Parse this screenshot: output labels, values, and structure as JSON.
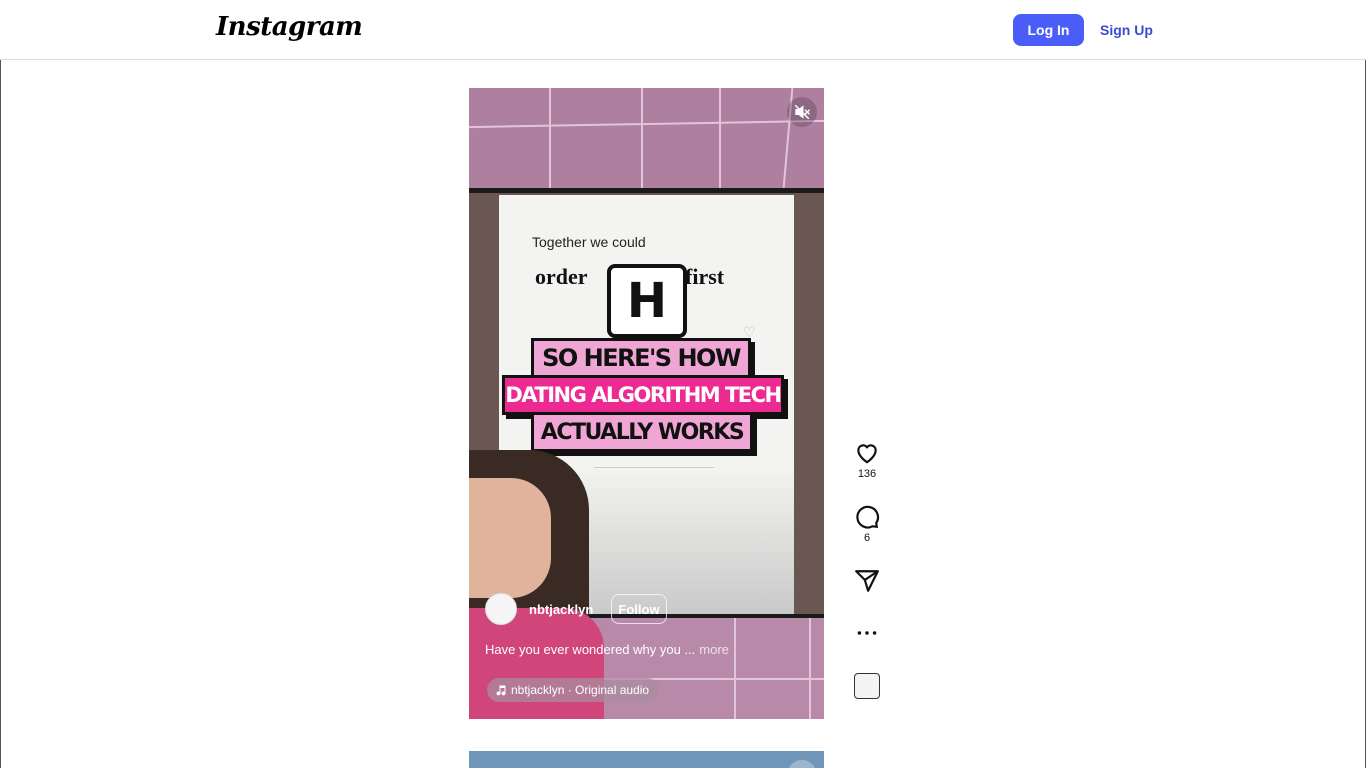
{
  "header": {
    "logo": "Instagram",
    "login_label": "Log In",
    "signup_label": "Sign Up"
  },
  "reel": {
    "overlay": {
      "line1": "Together we could",
      "line2_left": "order",
      "line2_right": "first",
      "logo_letter": "H",
      "banner1": "SO HERE'S HOW",
      "banner2": "DATING ALGORITHM TECH",
      "banner3": "ACTUALLY WORKS"
    },
    "username": "nbtjacklyn",
    "follow_label": "Follow",
    "caption": "Have you ever wondered why you ...",
    "more_label": "more",
    "audio": "nbtjacklyn · Original audio"
  },
  "actions": {
    "likes": "136",
    "comments": "6"
  },
  "colors": {
    "accent": "#4a5df9",
    "signup": "#3b4bd0",
    "banner_pink": "#ec2a92",
    "banner_light": "#f0a6d4"
  },
  "icons": [
    "mute-icon",
    "heart-icon",
    "comment-icon",
    "share-icon",
    "more-icon",
    "music-icon"
  ]
}
